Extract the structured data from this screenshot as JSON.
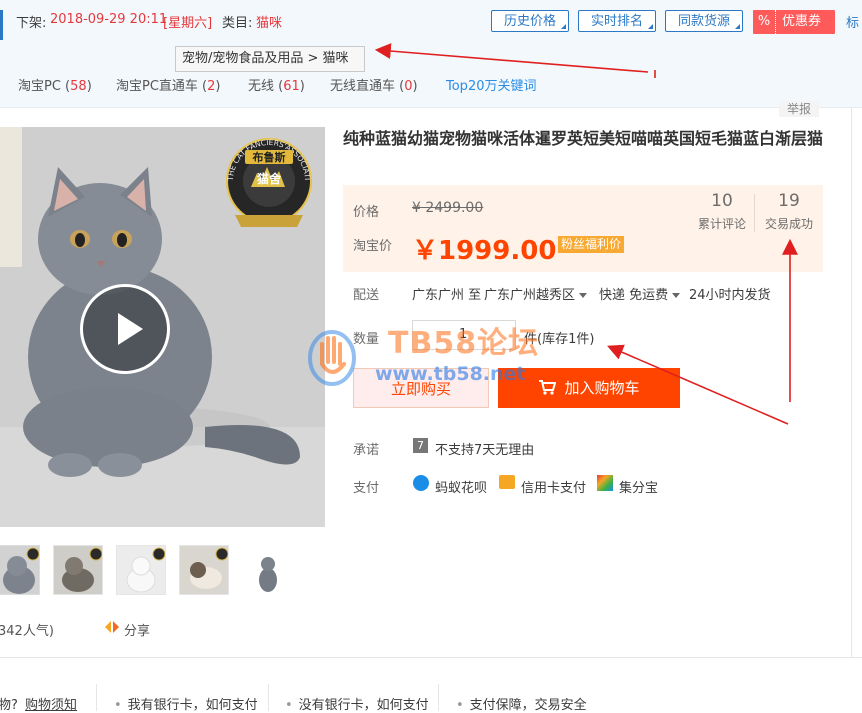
{
  "topbar": {
    "delist_label": "下架:",
    "delist_time": "2018-09-29 20:11",
    "delist_day": "[星期六]",
    "category_label": "类目:",
    "category_value": "猫咪",
    "buttons": [
      "历史价格",
      "实时排名",
      "同款货源"
    ],
    "coupon_pct": "%",
    "coupon_label": "优惠券",
    "edge_text": "标",
    "tooltip": "宠物/宠物食品及用品 > 猫咪"
  },
  "stats": [
    {
      "label": "淘宝PC",
      "count": "58"
    },
    {
      "label": "淘宝PC直通车",
      "count": "2"
    },
    {
      "label": "无线",
      "count": "61"
    },
    {
      "label": "无线直通车",
      "count": "0"
    }
  ],
  "top20_link": "Top20万关键词",
  "report_label": "举报",
  "product": {
    "title": "纯种蓝猫幼猫宠物猫咪活体暹罗英短美短喵喵英国短毛猫蓝白渐层猫",
    "price_label": "价格",
    "old_price": "¥ 2499.00",
    "taobao_price_label": "淘宝价",
    "new_price": "￥1999.00",
    "promo_tag": "粉丝福利价",
    "review_count": "10",
    "review_label": "累计评论",
    "sales_count": "19",
    "sales_label": "交易成功"
  },
  "delivery": {
    "label": "配送",
    "from": "广东广州 至",
    "to": "广东广州越秀区",
    "express": "快递 免运费",
    "ship_time": "24小时内发货"
  },
  "quantity": {
    "label": "数量",
    "value": "1",
    "unit_stock": "件(库存1件)"
  },
  "buttons": {
    "buy_now": "立即购买",
    "add_cart": "加入购物车"
  },
  "promise": {
    "label": "承诺",
    "icon_text": "7",
    "text": "不支持7天无理由"
  },
  "payment": {
    "label": "支付",
    "methods": [
      "蚂蚁花呗",
      "信用卡支付",
      "集分宝"
    ]
  },
  "watermark": {
    "text": "TB58论坛",
    "url": "www.tb58.net"
  },
  "badge": {
    "arc_text": "THE CAT FANCIERS'ASSOCIATION",
    "name_line1": "布鲁斯",
    "name_line2": "猫舍"
  },
  "popularity": "342人气)",
  "share_label": "分享",
  "footer": {
    "items": [
      "物?",
      "购物须知",
      "我有银行卡，如何支付",
      "没有银行卡，如何支付",
      "支付保障，交易安全"
    ]
  },
  "colors": {
    "accent": "#ff4400",
    "link": "#2b8ee6",
    "price_bg": "#fff2e8",
    "annotation_arrow": "#e02020"
  }
}
